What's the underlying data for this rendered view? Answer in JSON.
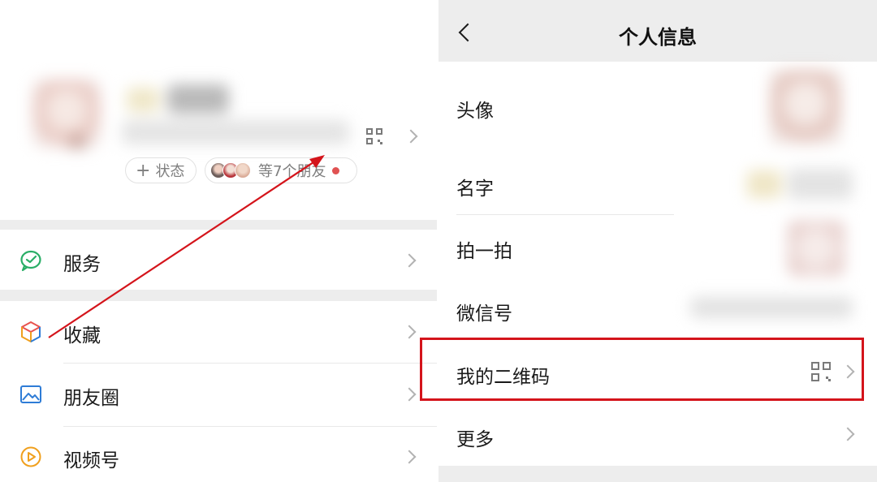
{
  "left": {
    "status_pill": {
      "plus": "+",
      "label": "状态"
    },
    "friends_pill": {
      "label": "等7个朋友"
    },
    "menu": [
      {
        "label": "服务",
        "icon": "service-icon"
      },
      {
        "label": "收藏",
        "icon": "favorites-box-icon"
      },
      {
        "label": "朋友圈",
        "icon": "moments-image-icon"
      },
      {
        "label": "视频号",
        "icon": "channels-play-icon"
      }
    ]
  },
  "right": {
    "nav_title": "个人信息",
    "rows": [
      {
        "label": "头像"
      },
      {
        "label": "名字"
      },
      {
        "label": "拍一拍"
      },
      {
        "label": "微信号"
      },
      {
        "label": "我的二维码"
      },
      {
        "label": "更多"
      }
    ]
  },
  "colors": {
    "annotation_red": "#d4141b",
    "service_green": "#2aae67",
    "moments_blue": "#2e7cd6",
    "channels_orange": "#f0a01e",
    "separator_gray": "#ededed"
  }
}
